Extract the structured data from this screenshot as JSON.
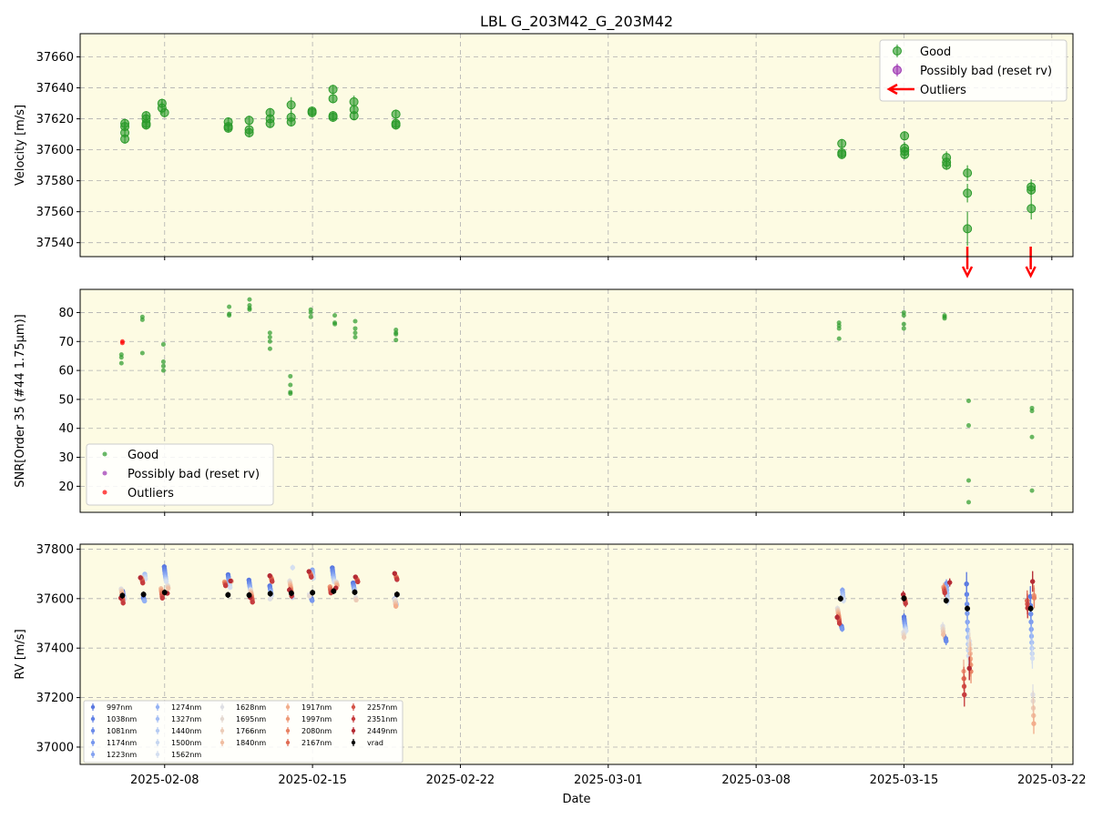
{
  "title": "LBL G_203M42_G_203M42",
  "xlabel": "Date",
  "colors": {
    "panel_bg": "#fdfbe3",
    "good": "#2a9a2a",
    "possibly_bad": "#9b30b0",
    "outliers": "#ff0000",
    "vrad": "#000000",
    "grid": "#b0b0b0"
  },
  "x_axis": {
    "type": "date",
    "range": [
      "2025-02-04",
      "2025-03-23"
    ],
    "ticks": [
      "2025-02-08",
      "2025-02-15",
      "2025-02-22",
      "2025-03-01",
      "2025-03-08",
      "2025-03-15",
      "2025-03-22"
    ]
  },
  "chart_data": [
    {
      "type": "scatter",
      "name": "velocity-panel",
      "ylabel": "Velocity [m/s]",
      "ylim": [
        37531,
        37675
      ],
      "yticks": [
        37540,
        37560,
        37580,
        37600,
        37620,
        37640,
        37660
      ],
      "legend": {
        "placement": "top-right",
        "entries": [
          "Good",
          "Possibly bad (reset rv)",
          "Outliers"
        ]
      },
      "good_points": [
        {
          "x": "2025-02-06",
          "y": 37617,
          "err": 3
        },
        {
          "x": "2025-02-06",
          "y": 37615,
          "err": 3
        },
        {
          "x": "2025-02-06",
          "y": 37611,
          "err": 3
        },
        {
          "x": "2025-02-06",
          "y": 37607,
          "err": 3
        },
        {
          "x": "2025-02-07",
          "y": 37622,
          "err": 3
        },
        {
          "x": "2025-02-07",
          "y": 37620,
          "err": 3
        },
        {
          "x": "2025-02-07",
          "y": 37616,
          "err": 3
        },
        {
          "x": "2025-02-07",
          "y": 37617,
          "err": 3
        },
        {
          "x": "2025-02-08",
          "y": 37630,
          "err": 3
        },
        {
          "x": "2025-02-08",
          "y": 37627,
          "err": 4
        },
        {
          "x": "2025-02-08",
          "y": 37624,
          "err": 3
        },
        {
          "x": "2025-02-11",
          "y": 37618,
          "err": 3
        },
        {
          "x": "2025-02-11",
          "y": 37614,
          "err": 3
        },
        {
          "x": "2025-02-11",
          "y": 37615,
          "err": 3
        },
        {
          "x": "2025-02-12",
          "y": 37619,
          "err": 3
        },
        {
          "x": "2025-02-12",
          "y": 37613,
          "err": 3
        },
        {
          "x": "2025-02-12",
          "y": 37611,
          "err": 3
        },
        {
          "x": "2025-02-13",
          "y": 37624,
          "err": 3
        },
        {
          "x": "2025-02-13",
          "y": 37620,
          "err": 3
        },
        {
          "x": "2025-02-13",
          "y": 37617,
          "err": 3
        },
        {
          "x": "2025-02-14",
          "y": 37629,
          "err": 5
        },
        {
          "x": "2025-02-14",
          "y": 37621,
          "err": 4
        },
        {
          "x": "2025-02-14",
          "y": 37618,
          "err": 3
        },
        {
          "x": "2025-02-15",
          "y": 37625,
          "err": 3
        },
        {
          "x": "2025-02-15",
          "y": 37624,
          "err": 3
        },
        {
          "x": "2025-02-16",
          "y": 37639,
          "err": 3
        },
        {
          "x": "2025-02-16",
          "y": 37633,
          "err": 3
        },
        {
          "x": "2025-02-16",
          "y": 37622,
          "err": 3
        },
        {
          "x": "2025-02-16",
          "y": 37621,
          "err": 3
        },
        {
          "x": "2025-02-17",
          "y": 37631,
          "err": 4
        },
        {
          "x": "2025-02-17",
          "y": 37626,
          "err": 3
        },
        {
          "x": "2025-02-17",
          "y": 37622,
          "err": 3
        },
        {
          "x": "2025-02-19",
          "y": 37623,
          "err": 3
        },
        {
          "x": "2025-02-19",
          "y": 37617,
          "err": 3
        },
        {
          "x": "2025-02-19",
          "y": 37616,
          "err": 3
        },
        {
          "x": "2025-03-12",
          "y": 37604,
          "err": 3
        },
        {
          "x": "2025-03-12",
          "y": 37598,
          "err": 3
        },
        {
          "x": "2025-03-12",
          "y": 37597,
          "err": 3
        },
        {
          "x": "2025-03-15",
          "y": 37609,
          "err": 3
        },
        {
          "x": "2025-03-15",
          "y": 37601,
          "err": 4
        },
        {
          "x": "2025-03-15",
          "y": 37599,
          "err": 3
        },
        {
          "x": "2025-03-15",
          "y": 37597,
          "err": 3
        },
        {
          "x": "2025-03-17",
          "y": 37595,
          "err": 4
        },
        {
          "x": "2025-03-17",
          "y": 37592,
          "err": 3
        },
        {
          "x": "2025-03-17",
          "y": 37590,
          "err": 3
        },
        {
          "x": "2025-03-18",
          "y": 37585,
          "err": 5
        },
        {
          "x": "2025-03-18",
          "y": 37572,
          "err": 6
        },
        {
          "x": "2025-03-18",
          "y": 37549,
          "err": 11
        },
        {
          "x": "2025-03-21",
          "y": 37576,
          "err": 5
        },
        {
          "x": "2025-03-21",
          "y": 37574,
          "err": 5
        },
        {
          "x": "2025-03-21",
          "y": 37562,
          "err": 7
        }
      ],
      "outlier_arrows_x": [
        "2025-03-18",
        "2025-03-21"
      ]
    },
    {
      "type": "scatter",
      "name": "snr-panel",
      "ylabel": "SNR[Order 35 (#44 1.75μm)]",
      "ylim": [
        11,
        88
      ],
      "yticks": [
        20,
        30,
        40,
        50,
        60,
        70,
        80
      ],
      "legend": {
        "placement": "bottom-left",
        "entries": [
          "Good",
          "Possibly bad (reset rv)",
          "Outliers"
        ]
      },
      "good_points": [
        {
          "x": "2025-02-06",
          "y": 65.5
        },
        {
          "x": "2025-02-06",
          "y": 64.5
        },
        {
          "x": "2025-02-06",
          "y": 62.5
        },
        {
          "x": "2025-02-07",
          "y": 78.5
        },
        {
          "x": "2025-02-07",
          "y": 77.5
        },
        {
          "x": "2025-02-07",
          "y": 66
        },
        {
          "x": "2025-02-08",
          "y": 69
        },
        {
          "x": "2025-02-08",
          "y": 63
        },
        {
          "x": "2025-02-08",
          "y": 61.5
        },
        {
          "x": "2025-02-08",
          "y": 60
        },
        {
          "x": "2025-02-11",
          "y": 82
        },
        {
          "x": "2025-02-11",
          "y": 79.5
        },
        {
          "x": "2025-02-11",
          "y": 79
        },
        {
          "x": "2025-02-12",
          "y": 84.5
        },
        {
          "x": "2025-02-12",
          "y": 82.5
        },
        {
          "x": "2025-02-12",
          "y": 81.5
        },
        {
          "x": "2025-02-12",
          "y": 81
        },
        {
          "x": "2025-02-13",
          "y": 73
        },
        {
          "x": "2025-02-13",
          "y": 71.5
        },
        {
          "x": "2025-02-13",
          "y": 70
        },
        {
          "x": "2025-02-13",
          "y": 67.5
        },
        {
          "x": "2025-02-14",
          "y": 58
        },
        {
          "x": "2025-02-14",
          "y": 55
        },
        {
          "x": "2025-02-14",
          "y": 52.5
        },
        {
          "x": "2025-02-14",
          "y": 52
        },
        {
          "x": "2025-02-15",
          "y": 81
        },
        {
          "x": "2025-02-15",
          "y": 80
        },
        {
          "x": "2025-02-15",
          "y": 78.5
        },
        {
          "x": "2025-02-16",
          "y": 79
        },
        {
          "x": "2025-02-16",
          "y": 76.5
        },
        {
          "x": "2025-02-16",
          "y": 76
        },
        {
          "x": "2025-02-17",
          "y": 77
        },
        {
          "x": "2025-02-17",
          "y": 74.5
        },
        {
          "x": "2025-02-17",
          "y": 73
        },
        {
          "x": "2025-02-17",
          "y": 71.5
        },
        {
          "x": "2025-02-19",
          "y": 74
        },
        {
          "x": "2025-02-19",
          "y": 73
        },
        {
          "x": "2025-02-19",
          "y": 72.5
        },
        {
          "x": "2025-02-19",
          "y": 70.5
        },
        {
          "x": "2025-03-12",
          "y": 76.5
        },
        {
          "x": "2025-03-12",
          "y": 75.5
        },
        {
          "x": "2025-03-12",
          "y": 74.5
        },
        {
          "x": "2025-03-12",
          "y": 71
        },
        {
          "x": "2025-03-15",
          "y": 80
        },
        {
          "x": "2025-03-15",
          "y": 79
        },
        {
          "x": "2025-03-15",
          "y": 76
        },
        {
          "x": "2025-03-15",
          "y": 74.5
        },
        {
          "x": "2025-03-17",
          "y": 79
        },
        {
          "x": "2025-03-17",
          "y": 78.5
        },
        {
          "x": "2025-03-17",
          "y": 78
        },
        {
          "x": "2025-03-18",
          "y": 49.5
        },
        {
          "x": "2025-03-18",
          "y": 41
        },
        {
          "x": "2025-03-18",
          "y": 22
        },
        {
          "x": "2025-03-18",
          "y": 14.5
        },
        {
          "x": "2025-03-21",
          "y": 47
        },
        {
          "x": "2025-03-21",
          "y": 46
        },
        {
          "x": "2025-03-21",
          "y": 37
        },
        {
          "x": "2025-03-21",
          "y": 18.5
        }
      ],
      "outlier_points": [
        {
          "x": "2025-02-06",
          "y": 70
        },
        {
          "x": "2025-02-06",
          "y": 69.5
        }
      ]
    },
    {
      "type": "scatter",
      "name": "rv-panel",
      "ylabel": "RV [m/s]",
      "ylim": [
        36930,
        37820
      ],
      "yticks": [
        37000,
        37200,
        37400,
        37600,
        37800
      ],
      "legend": {
        "placement": "bottom-left",
        "columns": [
          [
            "997nm",
            "1038nm",
            "1081nm",
            "1174nm",
            "1223nm"
          ],
          [
            "1274nm",
            "1327nm",
            "1440nm",
            "1500nm",
            "1562nm"
          ],
          [
            "1628nm",
            "1695nm",
            "1766nm",
            "1840nm"
          ],
          [
            "1917nm",
            "1997nm",
            "2080nm",
            "2167nm"
          ],
          [
            "2257nm",
            "2351nm",
            "2449nm",
            "vrad"
          ]
        ],
        "column_colors": [
          [
            "#5a78e0",
            "#6282e6",
            "#6c8cea",
            "#7898ee",
            "#86a4f0"
          ],
          [
            "#94b2f4",
            "#a4bef4",
            "#b6cbf2",
            "#c6d6f0",
            "#d4dff0"
          ],
          [
            "#dedfe4",
            "#e4d8d0",
            "#ecccb8",
            "#f0bea2"
          ],
          [
            "#f2ae8c",
            "#ee9a78",
            "#e88264",
            "#e06c54"
          ],
          [
            "#d45448",
            "#c63c3e",
            "#b42a34",
            "#000000"
          ]
        ]
      },
      "epochs": [
        {
          "x": "2025-02-06",
          "vrad": 37612,
          "spread": [
            37565,
            37725
          ]
        },
        {
          "x": "2025-02-07",
          "vrad": 37617,
          "spread": [
            37575,
            37720
          ]
        },
        {
          "x": "2025-02-08",
          "vrad": 37625,
          "spread": [
            37580,
            37730
          ]
        },
        {
          "x": "2025-02-11",
          "vrad": 37615,
          "spread": [
            37570,
            37700
          ]
        },
        {
          "x": "2025-02-12",
          "vrad": 37614,
          "spread": [
            37560,
            37710
          ]
        },
        {
          "x": "2025-02-13",
          "vrad": 37620,
          "spread": [
            37565,
            37720
          ]
        },
        {
          "x": "2025-02-14",
          "vrad": 37622,
          "spread": [
            37570,
            37760
          ]
        },
        {
          "x": "2025-02-15",
          "vrad": 37624,
          "spread": [
            37580,
            37730
          ]
        },
        {
          "x": "2025-02-16",
          "vrad": 37630,
          "spread": [
            37585,
            37735
          ]
        },
        {
          "x": "2025-02-17",
          "vrad": 37626,
          "spread": [
            37570,
            37700
          ]
        },
        {
          "x": "2025-02-19",
          "vrad": 37617,
          "spread": [
            37550,
            37710
          ]
        },
        {
          "x": "2025-03-12",
          "vrad": 37600,
          "spread": [
            37460,
            37650
          ]
        },
        {
          "x": "2025-03-15",
          "vrad": 37601,
          "spread": [
            37400,
            37640
          ]
        },
        {
          "x": "2025-03-17",
          "vrad": 37592,
          "spread": [
            37410,
            37680
          ]
        },
        {
          "x": "2025-03-18",
          "vrad": 37560,
          "spread": [
            36950,
            37740
          ]
        },
        {
          "x": "2025-03-21",
          "vrad": 37560,
          "spread": [
            37000,
            37690
          ]
        }
      ]
    }
  ]
}
